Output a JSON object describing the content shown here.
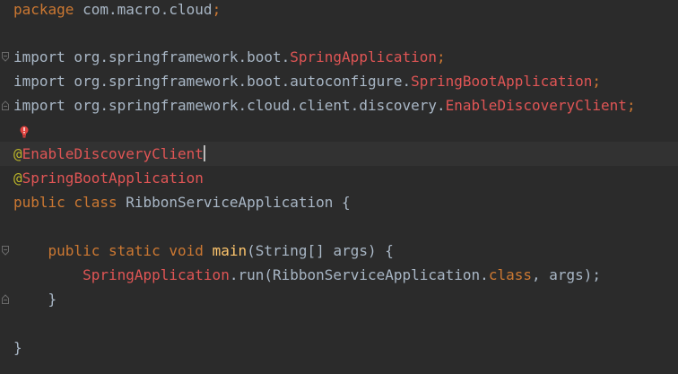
{
  "colors": {
    "background": "#2b2b2b",
    "current_line": "#323232",
    "keyword": "#cc7832",
    "annotation": "#bbb529",
    "unresolved": "#e05555",
    "method": "#ffc66d",
    "text": "#a9b7c6"
  },
  "icons": {
    "gutter_bulb": "red-lightbulb-icon",
    "fold_marker": "fold-marker-icon"
  },
  "code": {
    "package_kw": "package",
    "package_name": " com.macro.cloud",
    "semicolon": ";",
    "import_kw": "import",
    "import1_pkg": " org.springframework.boot.",
    "import1_class": "SpringApplication",
    "import2_pkg": " org.springframework.boot.autoconfigure.",
    "import2_class": "SpringBootApplication",
    "import3_pkg": " org.springframework.cloud.client.discovery.",
    "import3_class": "EnableDiscoveryClient",
    "at": "@",
    "ann1_name": "EnableDiscoveryClient",
    "ann2_name": "SpringBootApplication",
    "public_kw": "public",
    "class_kw": " class",
    "class_name": " RibbonServiceApplication {",
    "static_kw": " static",
    "void_kw": " void",
    "main_name": " main",
    "main_params": "(String[] args) {",
    "call_class": "SpringApplication",
    "call_rest": ".run(RibbonServiceApplication.",
    "class_literal": "class",
    "call_args": ", args);",
    "close_brace": "}"
  }
}
